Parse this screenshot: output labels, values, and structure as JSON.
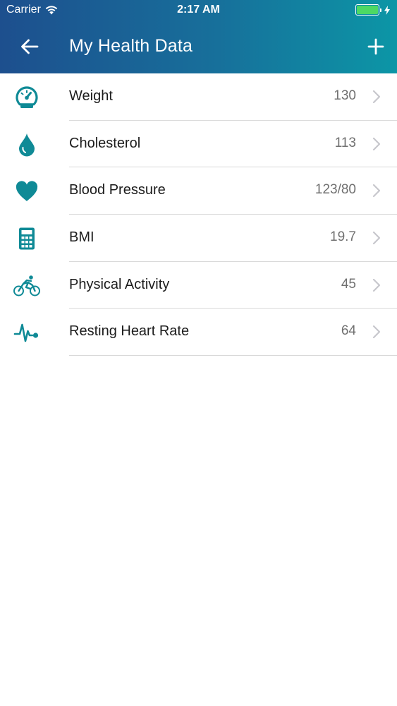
{
  "status_bar": {
    "carrier": "Carrier",
    "time": "2:17 AM",
    "battery_color": "#4cd964"
  },
  "nav": {
    "title": "My Health Data",
    "back_icon": "arrow-left-icon",
    "add_icon": "plus-icon"
  },
  "colors": {
    "accent": "#0f8a96",
    "header_start": "#1d4f8e",
    "header_end": "#0c96a6"
  },
  "items": [
    {
      "label": "Weight",
      "value": "130",
      "icon": "scale-gauge-icon"
    },
    {
      "label": "Cholesterol",
      "value": "113",
      "icon": "droplet-icon"
    },
    {
      "label": "Blood Pressure",
      "value": "123/80",
      "icon": "heart-icon"
    },
    {
      "label": "BMI",
      "value": "19.7",
      "icon": "calculator-icon"
    },
    {
      "label": "Physical Activity",
      "value": "45",
      "icon": "bicycle-icon"
    },
    {
      "label": "Resting Heart Rate",
      "value": "64",
      "icon": "heartbeat-icon"
    }
  ]
}
